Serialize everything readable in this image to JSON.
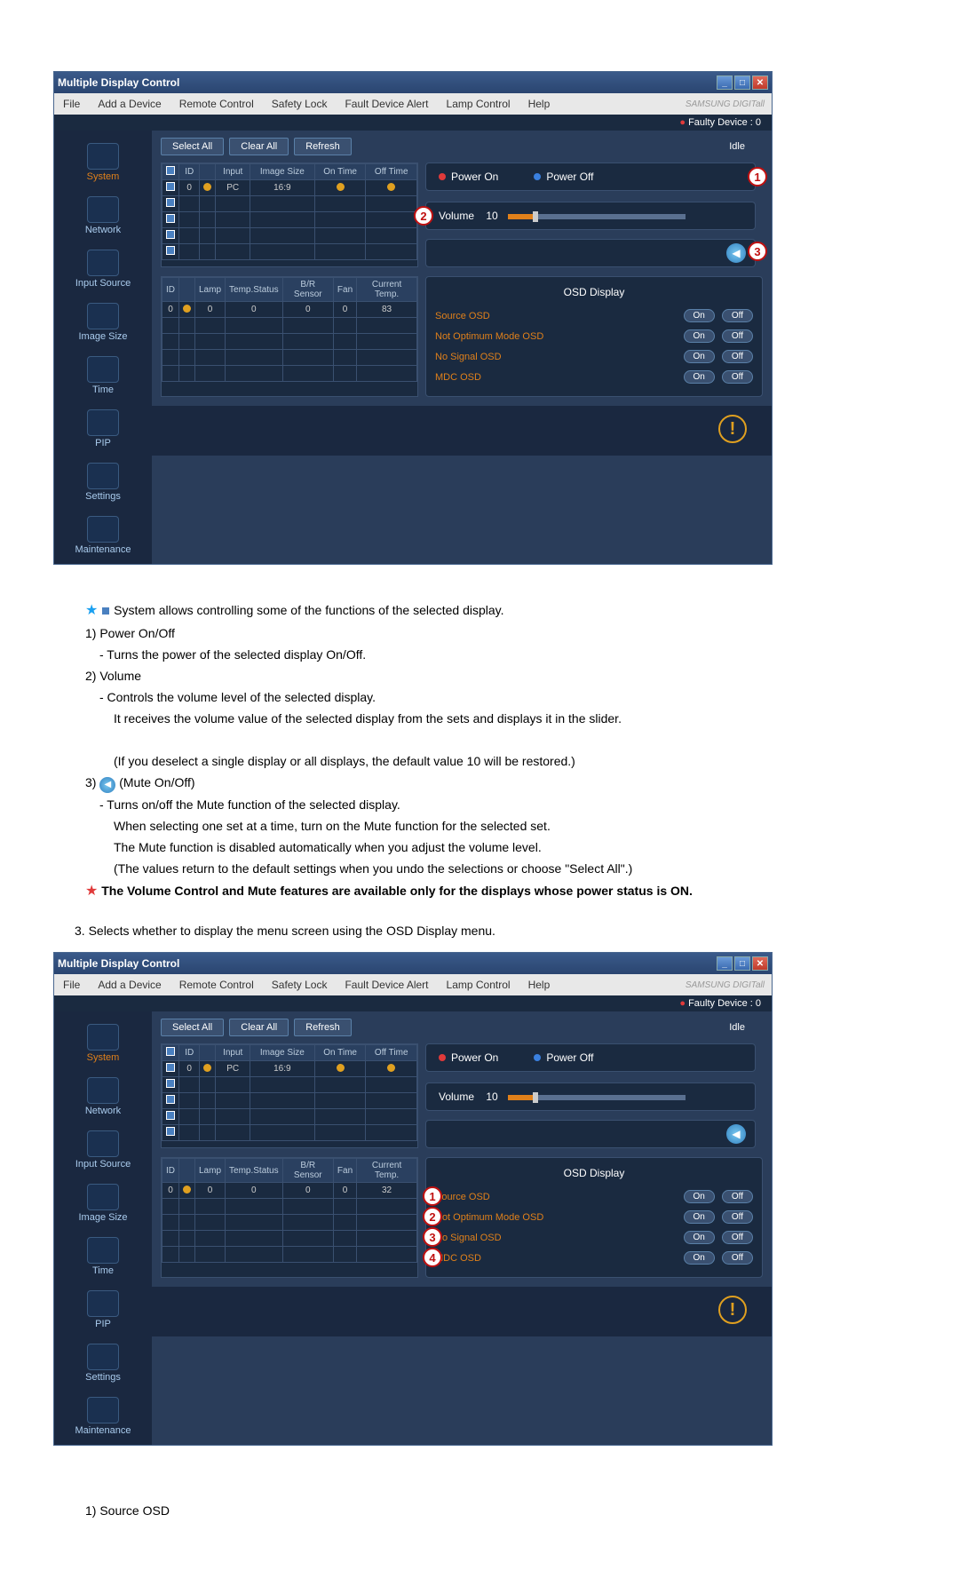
{
  "window": {
    "title": "Multiple Display Control",
    "brand": "SAMSUNG DIGITall"
  },
  "menu": {
    "file": "File",
    "add": "Add a Device",
    "remote": "Remote Control",
    "safety": "Safety Lock",
    "fault": "Fault Device Alert",
    "lamp": "Lamp Control",
    "help": "Help"
  },
  "status_strip": "Faulty Device : 0",
  "sidebar": {
    "items": [
      {
        "label": "System"
      },
      {
        "label": "Network"
      },
      {
        "label": "Input Source"
      },
      {
        "label": "Image Size"
      },
      {
        "label": "Time"
      },
      {
        "label": "PIP"
      },
      {
        "label": "Settings"
      },
      {
        "label": "Maintenance"
      }
    ]
  },
  "toolbar": {
    "select_all": "Select All",
    "clear_all": "Clear All",
    "refresh": "Refresh",
    "idle": "Idle"
  },
  "power": {
    "on": "Power On",
    "off": "Power Off"
  },
  "volume": {
    "label": "Volume",
    "value": "10"
  },
  "table1": {
    "headers": [
      "",
      "ID",
      "",
      "Input",
      "Image Size",
      "On Time",
      "Off Time"
    ],
    "row": {
      "id": "0",
      "input": "PC",
      "imgsize": "16:9"
    }
  },
  "table2": {
    "headers": [
      "ID",
      "",
      "Lamp",
      "Temp.Status",
      "B/R Sensor",
      "Fan",
      "Current Temp."
    ],
    "rowA": {
      "id": "0",
      "lamp": "0",
      "temp": "0",
      "br": "0",
      "fan": "0",
      "cur": "83"
    },
    "rowB": {
      "id": "0",
      "lamp": "0",
      "temp": "0",
      "br": "0",
      "fan": "0",
      "cur": "32"
    }
  },
  "osd": {
    "header": "OSD Display",
    "rows": [
      {
        "label": "Source OSD"
      },
      {
        "label": "Not Optimum Mode OSD"
      },
      {
        "label": "No Signal OSD"
      },
      {
        "label": "MDC OSD"
      }
    ],
    "on": "On",
    "off": "Off"
  },
  "callouts": {
    "c1": "1",
    "c2": "2",
    "c3": "3",
    "c4": "4"
  },
  "doc": {
    "p0": "System allows controlling some of the functions of the selected display.",
    "l1": "1)  Power On/Off",
    "l1a": "- Turns the power of the selected display On/Off.",
    "l2": "2)  Volume",
    "l2a": "- Controls the volume level of the selected display.",
    "l2b": "It receives the volume value of the selected display from the sets and displays it in the slider.",
    "l2c": "(If you deselect a single display or all displays, the default value 10 will be restored.)",
    "l3": "3)",
    "l3t": "(Mute On/Off)",
    "l3a": "- Turns on/off the Mute function of the selected display.",
    "l3b": "When selecting one set at a time, turn on the Mute function for the selected set.",
    "l3c": "The Mute function is disabled automatically when you adjust the volume level.",
    "l3d": "(The values return to the default settings when you undo the selections or choose \"Select All\".)",
    "note1": "The Volume Control and Mute features are available only for the displays whose power status is ON.",
    "desc3": "3. Selects whether to display the menu screen using the OSD Display menu.",
    "src_osd": "1)  Source OSD"
  }
}
